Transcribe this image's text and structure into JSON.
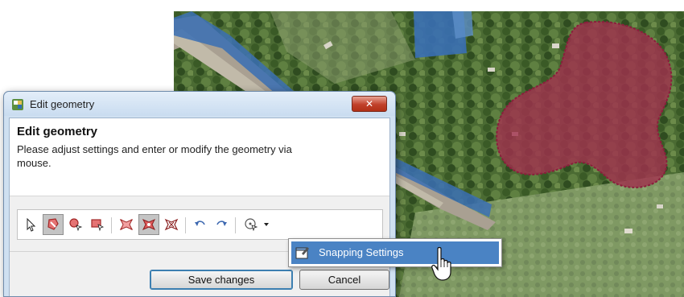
{
  "window": {
    "title": "Edit geometry",
    "close_label": "✕"
  },
  "header": {
    "title": "Edit geometry",
    "description": "Please adjust settings and enter or modify the geometry via mouse."
  },
  "toolbar": {
    "tools": [
      {
        "name": "select-arrow-icon",
        "pressed": false
      },
      {
        "name": "edit-polygon-icon",
        "pressed": true
      },
      {
        "name": "zoom-select-icon",
        "pressed": false
      },
      {
        "name": "rect-select-icon",
        "pressed": false
      },
      {
        "name": "split-geometry-icon",
        "pressed": false
      },
      {
        "name": "merge-geometry-icon",
        "pressed": true
      },
      {
        "name": "delete-vertex-icon",
        "pressed": false
      },
      {
        "name": "undo-icon",
        "pressed": false
      },
      {
        "name": "redo-icon",
        "pressed": false
      },
      {
        "name": "snapping-icon",
        "pressed": false
      }
    ]
  },
  "buttons": {
    "save": "Save changes",
    "cancel": "Cancel"
  },
  "menu": {
    "items": [
      {
        "label": "Snapping Settings",
        "icon": "snapping-settings-icon",
        "highlighted": true
      }
    ]
  },
  "colors": {
    "highlight_polygon": "#a0324e",
    "selected_parcel": "#3a6fb4",
    "menu_highlight": "#4a83c4"
  }
}
